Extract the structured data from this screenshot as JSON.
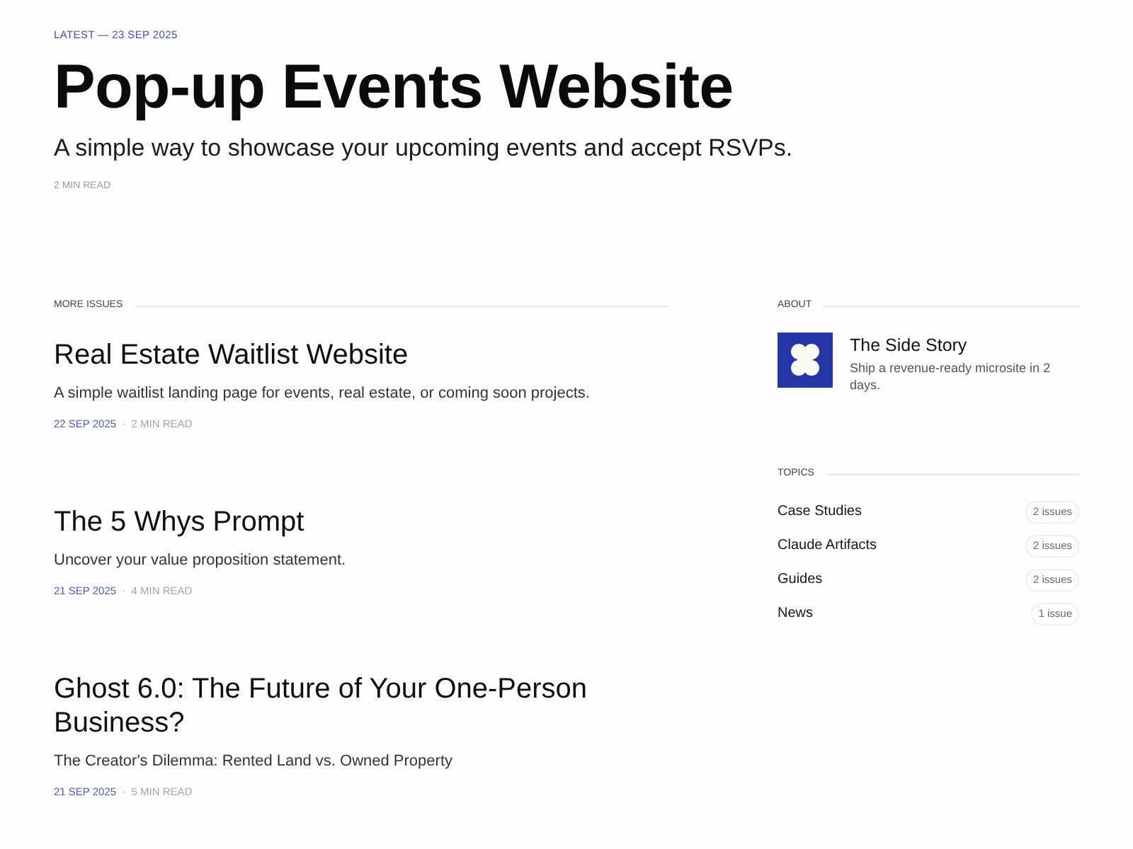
{
  "hero": {
    "eyebrow": "LATEST — 23 SEP 2025",
    "title": "Pop-up Events Website",
    "subtitle": "A simple way to showcase your upcoming events and accept RSVPs.",
    "read_time": "2 MIN READ"
  },
  "more_issues": {
    "label": "MORE ISSUES",
    "posts": [
      {
        "title": "Real Estate Waitlist Website",
        "excerpt": "A simple waitlist landing page for events, real estate, or coming soon projects.",
        "date": "22 SEP 2025",
        "separator": "·",
        "read_time": "2 MIN READ"
      },
      {
        "title": "The 5 Whys Prompt",
        "excerpt": "Uncover your value proposition statement.",
        "date": "21 SEP 2025",
        "separator": "·",
        "read_time": "4 MIN READ"
      },
      {
        "title": "Ghost 6.0: The Future of Your One-Person Business?",
        "excerpt": "The Creator's Dilemma: Rented Land vs. Owned Property",
        "date": "21 SEP 2025",
        "separator": "·",
        "read_time": "5 MIN READ"
      }
    ]
  },
  "about": {
    "label": "ABOUT",
    "name": "The Side Story",
    "description": "Ship a revenue-ready microsite in 2 days."
  },
  "topics": {
    "label": "TOPICS",
    "items": [
      {
        "name": "Case Studies",
        "count": "2 issues"
      },
      {
        "name": "Claude Artifacts",
        "count": "2 issues"
      },
      {
        "name": "Guides",
        "count": "2 issues"
      },
      {
        "name": "News",
        "count": "1 issue"
      }
    ]
  }
}
